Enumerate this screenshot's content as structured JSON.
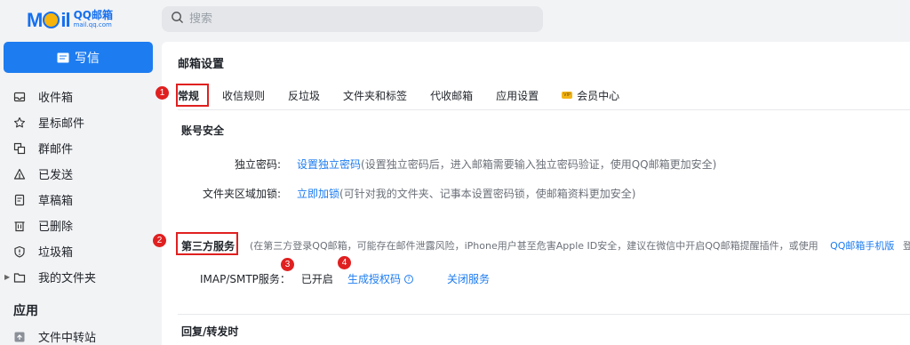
{
  "logo": {
    "mark": "Mail",
    "cn": "QQ邮箱",
    "en": "mail.qq.com"
  },
  "search": {
    "placeholder": "搜索"
  },
  "compose": {
    "label": "写信"
  },
  "sidebar": {
    "items": [
      {
        "label": "收件箱",
        "icon": "inbox-icon"
      },
      {
        "label": "星标邮件",
        "icon": "star-icon"
      },
      {
        "label": "群邮件",
        "icon": "group-mail-icon"
      },
      {
        "label": "已发送",
        "icon": "sent-icon"
      },
      {
        "label": "草稿箱",
        "icon": "draft-icon"
      },
      {
        "label": "已删除",
        "icon": "trash-icon"
      },
      {
        "label": "垃圾箱",
        "icon": "spam-icon"
      },
      {
        "label": "我的文件夹",
        "icon": "folder-icon"
      }
    ],
    "apps_title": "应用",
    "apps": [
      {
        "label": "文件中转站",
        "icon": "transfer-icon"
      }
    ]
  },
  "main": {
    "title": "邮箱设置",
    "tabs": [
      {
        "label": "常规"
      },
      {
        "label": "收信规则"
      },
      {
        "label": "反垃圾"
      },
      {
        "label": "文件夹和标签"
      },
      {
        "label": "代收邮箱"
      },
      {
        "label": "应用设置"
      },
      {
        "label": "会员中心",
        "badge": "VIP"
      }
    ],
    "account_security": {
      "title": "账号安全",
      "rows": [
        {
          "label": "独立密码:",
          "link": "设置独立密码",
          "note": "(设置独立密码后，进入邮箱需要输入独立密码验证，使用QQ邮箱更加安全)"
        },
        {
          "label": "文件夹区域加锁:",
          "link": "立即加锁",
          "note": "(可针对我的文件夹、记事本设置密码锁，使邮箱资料更加安全)"
        }
      ]
    },
    "third_party": {
      "title": "第三方服务",
      "desc": "(在第三方登录QQ邮箱，可能存在邮件泄露风险，iPhone用户甚至危害Apple ID安全，建议在微信中开启QQ邮箱提醒插件，或使用",
      "desc_link": "QQ邮箱手机版",
      "desc_tail": "登录。)",
      "imap": {
        "label": "IMAP/SMTP服务：",
        "status": "已开启",
        "gen_link": "生成授权码",
        "close_link": "关闭服务"
      }
    },
    "reply_title": "回复/转发时"
  },
  "annotations": [
    "1",
    "2",
    "3",
    "4"
  ],
  "colors": {
    "accent": "#1d7cf0",
    "highlight": "#e02020"
  }
}
